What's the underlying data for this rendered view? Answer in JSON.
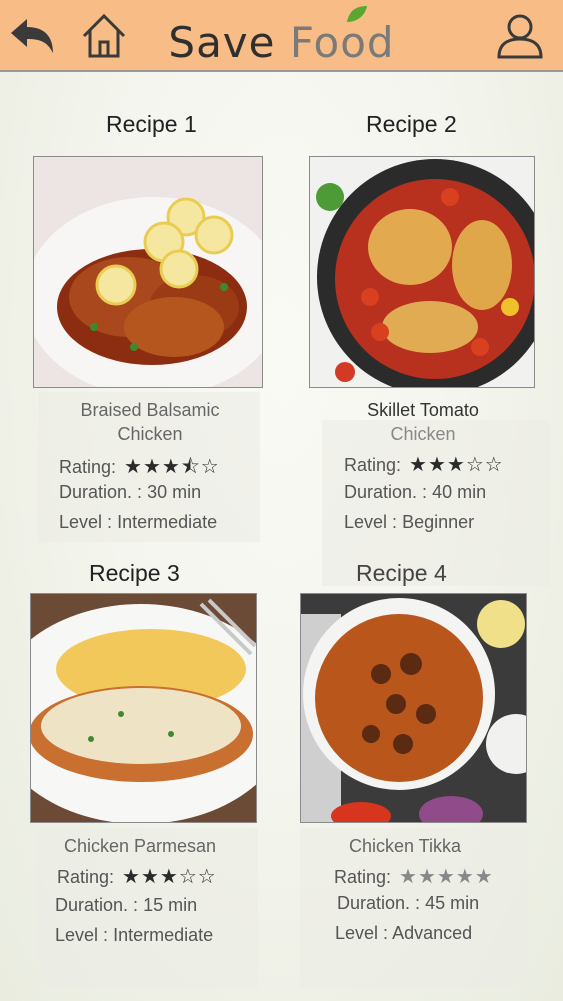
{
  "header": {
    "title_part1": "Save ",
    "title_part2": "Food"
  },
  "labels": {
    "rating": "Rating:",
    "duration": "Duration. :",
    "level": "Level :"
  },
  "recipes": [
    {
      "heading": "Recipe 1",
      "name_line1": "Braised Balsamic",
      "name_line2": "Chicken",
      "rating_stars": "★★★⯪☆",
      "rating_value": 3.5,
      "duration": "30 min",
      "level": "Intermediate"
    },
    {
      "heading": "Recipe 2",
      "name_line1": "Skillet Tomato",
      "name_line2": "Chicken",
      "rating_stars": "★★★☆☆",
      "rating_value": 3,
      "duration": "40 min",
      "level": "Beginner"
    },
    {
      "heading": "Recipe 3",
      "name_line1": "Chicken Parmesan",
      "rating_stars": "★★★☆☆",
      "rating_value": 3,
      "duration": "15 min",
      "level": "Intermediate"
    },
    {
      "heading": "Recipe 4",
      "name_line1": "Chicken Tikka",
      "rating_stars": "★★★★★",
      "rating_value": 5,
      "duration": "45 min",
      "level": "Advanced"
    }
  ],
  "colors": {
    "header_bg": "#f8bd86",
    "leaf": "#5aa832"
  },
  "icons": [
    "back-arrow-icon",
    "home-icon",
    "leaf-icon",
    "user-icon"
  ]
}
